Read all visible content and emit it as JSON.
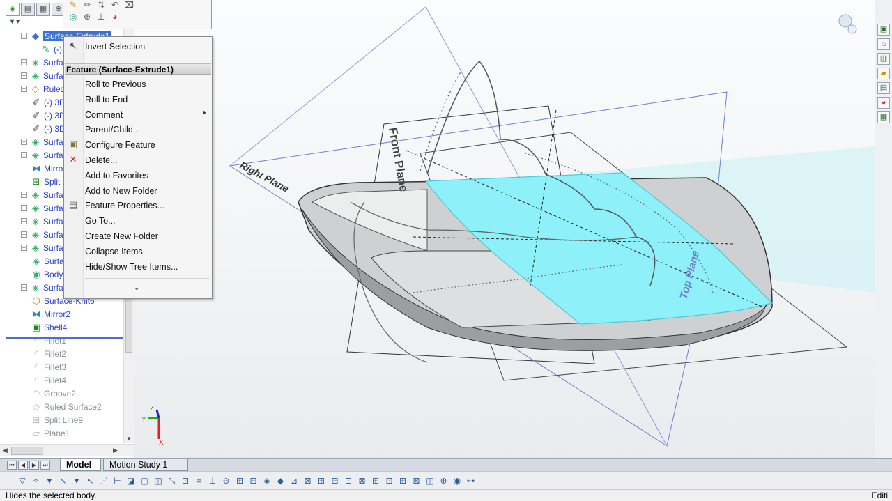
{
  "context_menu": {
    "top_item": "Invert Selection",
    "section_header": "Feature (Surface-Extrude1)",
    "items": [
      {
        "label": "Roll to Previous"
      },
      {
        "label": "Roll to End"
      },
      {
        "label": "Comment"
      },
      {
        "label": "Parent/Child..."
      },
      {
        "label": "Configure Feature"
      },
      {
        "label": "Delete..."
      },
      {
        "label": "Add to Favorites"
      },
      {
        "label": "Add to New Folder"
      },
      {
        "label": "Feature Properties..."
      },
      {
        "label": "Go To..."
      },
      {
        "label": "Create New Folder"
      },
      {
        "label": "Collapse Items"
      },
      {
        "label": "Hide/Show Tree Items..."
      }
    ],
    "more_glyph": "⌄"
  },
  "tree": {
    "items": [
      {
        "label": "Surface-Extrude1",
        "icon": "surface-extrude-icon",
        "state": "selected"
      },
      {
        "label": "(-)",
        "icon": "sketch-icon",
        "state": "normal"
      },
      {
        "label": "Surfa",
        "icon": "surface-icon",
        "state": "normal"
      },
      {
        "label": "Surfa",
        "icon": "surface-icon",
        "state": "normal"
      },
      {
        "label": "Ruled",
        "icon": "ruled-surface-icon",
        "state": "normal"
      },
      {
        "label": "(-) 3D",
        "icon": "3d-sketch-icon",
        "state": "normal"
      },
      {
        "label": "(-) 3D",
        "icon": "3d-sketch-icon",
        "state": "normal"
      },
      {
        "label": "(-) 3D",
        "icon": "3d-sketch-icon",
        "state": "normal"
      },
      {
        "label": "Surfa",
        "icon": "surface-icon",
        "state": "normal"
      },
      {
        "label": "Surfa",
        "icon": "surface-icon",
        "state": "normal"
      },
      {
        "label": "Mirro",
        "icon": "mirror-icon",
        "state": "normal"
      },
      {
        "label": "Split",
        "icon": "split-line-icon",
        "state": "normal"
      },
      {
        "label": "Surfa",
        "icon": "surface-icon",
        "state": "normal"
      },
      {
        "label": "Surfa",
        "icon": "surface-icon",
        "state": "normal"
      },
      {
        "label": "Surfa",
        "icon": "surface-icon",
        "state": "normal"
      },
      {
        "label": "Surfa",
        "icon": "surface-icon",
        "state": "normal"
      },
      {
        "label": "Surfa",
        "icon": "surface-icon",
        "state": "normal"
      },
      {
        "label": "Surfa",
        "icon": "surface-icon",
        "state": "normal"
      },
      {
        "label": "Body",
        "icon": "body-icon",
        "state": "normal"
      },
      {
        "label": "Surfa",
        "icon": "surface-icon",
        "state": "normal"
      },
      {
        "label": "Surface-Knit6",
        "icon": "knit-icon",
        "state": "normal"
      },
      {
        "label": "Mirror2",
        "icon": "mirror-icon",
        "state": "normal"
      },
      {
        "label": "Shell4",
        "icon": "shell-icon",
        "state": "normal"
      },
      {
        "label": "Fillet1",
        "icon": "fillet-icon",
        "state": "suppressed"
      },
      {
        "label": "Fillet2",
        "icon": "fillet-icon",
        "state": "suppressed"
      },
      {
        "label": "Fillet3",
        "icon": "fillet-icon",
        "state": "suppressed"
      },
      {
        "label": "Fillet4",
        "icon": "fillet-icon",
        "state": "suppressed"
      },
      {
        "label": "Groove2",
        "icon": "groove-icon",
        "state": "suppressed"
      },
      {
        "label": "Ruled Surface2",
        "icon": "ruled-surface-icon",
        "state": "suppressed"
      },
      {
        "label": "Split Line9",
        "icon": "split-line-icon",
        "state": "suppressed"
      },
      {
        "label": "Plane1",
        "icon": "plane-icon",
        "state": "suppressed"
      }
    ]
  },
  "bottom_tabs": {
    "model": "Model",
    "motion_study": "Motion Study 1"
  },
  "viewport": {
    "plane_labels": {
      "front": "Front Plane",
      "right": "Right Plane",
      "top": "Top Plane"
    },
    "triad": {
      "x": "X",
      "y": "Y",
      "z": "Z"
    }
  },
  "status_bar": {
    "text": "Hides the selected body.",
    "right_text": "Editi"
  },
  "colors": {
    "selection_blue": "#3a73d8",
    "surface_cyan": "#8ef0f8",
    "tree_text": "#2a3fd0"
  }
}
